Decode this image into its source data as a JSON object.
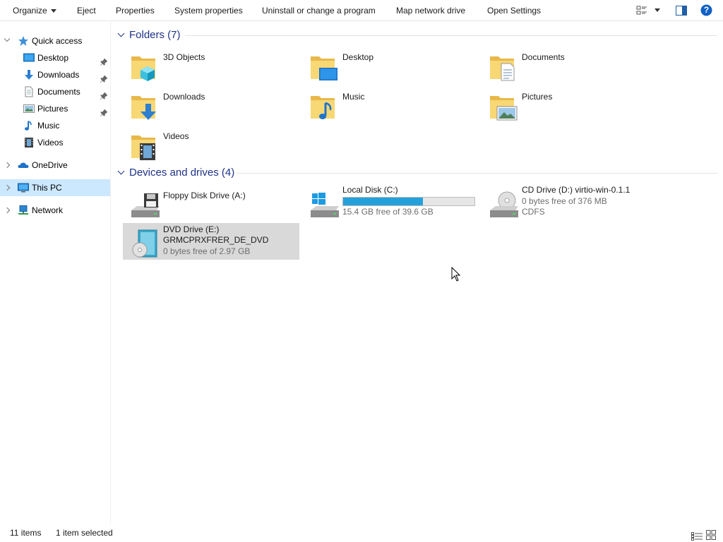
{
  "toolbar": {
    "organize": "Organize",
    "eject": "Eject",
    "properties": "Properties",
    "system_properties": "System properties",
    "uninstall": "Uninstall or change a program",
    "map_drive": "Map network drive",
    "open_settings": "Open Settings",
    "help": "?"
  },
  "nav": {
    "quick_access": "Quick access",
    "quick_items": [
      "Desktop",
      "Downloads",
      "Documents",
      "Pictures",
      "Music",
      "Videos"
    ],
    "onedrive": "OneDrive",
    "this_pc": "This PC",
    "network": "Network"
  },
  "folders": {
    "header": "Folders (7)",
    "items": [
      "3D Objects",
      "Desktop",
      "Documents",
      "Downloads",
      "Music",
      "Pictures",
      "Videos"
    ]
  },
  "devices": {
    "header": "Devices and drives (4)",
    "floppy": {
      "name": "Floppy Disk Drive (A:)"
    },
    "local": {
      "name": "Local Disk (C:)",
      "free": "15.4 GB free of 39.6 GB",
      "used_fraction": 0.61
    },
    "cd": {
      "name": "CD Drive (D:) virtio-win-0.1.1",
      "free": "0 bytes free of 376 MB",
      "fs": "CDFS"
    },
    "dvd": {
      "name": "DVD Drive (E:)",
      "label": "GRMCPRXFRER_DE_DVD",
      "free": "0 bytes free of 2.97 GB"
    }
  },
  "status": {
    "count": "11 items",
    "selected": "1 item selected"
  },
  "colors": {
    "accent": "#26a0da",
    "selection": "#cce8ff",
    "group_header": "#1e3287"
  }
}
